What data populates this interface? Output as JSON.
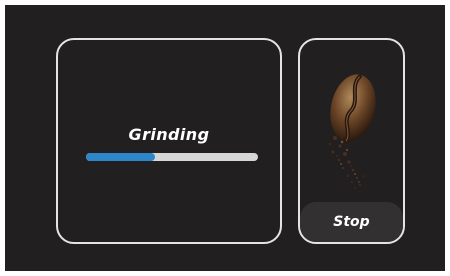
{
  "status": {
    "label": "Grinding",
    "progress_percent": 40,
    "progress_color": "#2e86c8",
    "track_color": "#d6d6d6"
  },
  "side_panel": {
    "image": "coffee-bean-grinding-image",
    "stop_label": "Stop"
  },
  "theme": {
    "background": "#221f20",
    "card_border": "#e6e3e3",
    "button_background": "#333031"
  }
}
